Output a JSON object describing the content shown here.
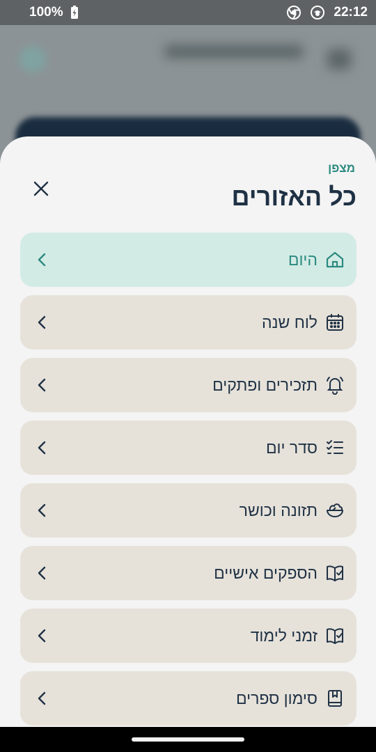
{
  "status_bar": {
    "battery": "100%",
    "time": "22:12"
  },
  "sheet": {
    "subtitle": "מצפן",
    "title": "כל האזורים"
  },
  "menu": [
    {
      "label": "היום",
      "icon": "home-icon",
      "active": true
    },
    {
      "label": "לוח שנה",
      "icon": "calendar-icon",
      "active": false
    },
    {
      "label": "תזכירים ופתקים",
      "icon": "bell-icon",
      "active": false
    },
    {
      "label": "סדר יום",
      "icon": "checklist-icon",
      "active": false
    },
    {
      "label": "תזונה וכושר",
      "icon": "salad-bowl-icon",
      "active": false
    },
    {
      "label": "הספקים אישיים",
      "icon": "book-check-icon",
      "active": false
    },
    {
      "label": "זמני לימוד",
      "icon": "book-check-icon",
      "active": false
    },
    {
      "label": "סימון ספרים",
      "icon": "bookmark-book-icon",
      "active": false
    }
  ],
  "colors": {
    "accent": "#2a8a80",
    "text_primary": "#1f3144",
    "item_bg": "#e6e2da",
    "item_active_bg": "#d3ebe5"
  }
}
